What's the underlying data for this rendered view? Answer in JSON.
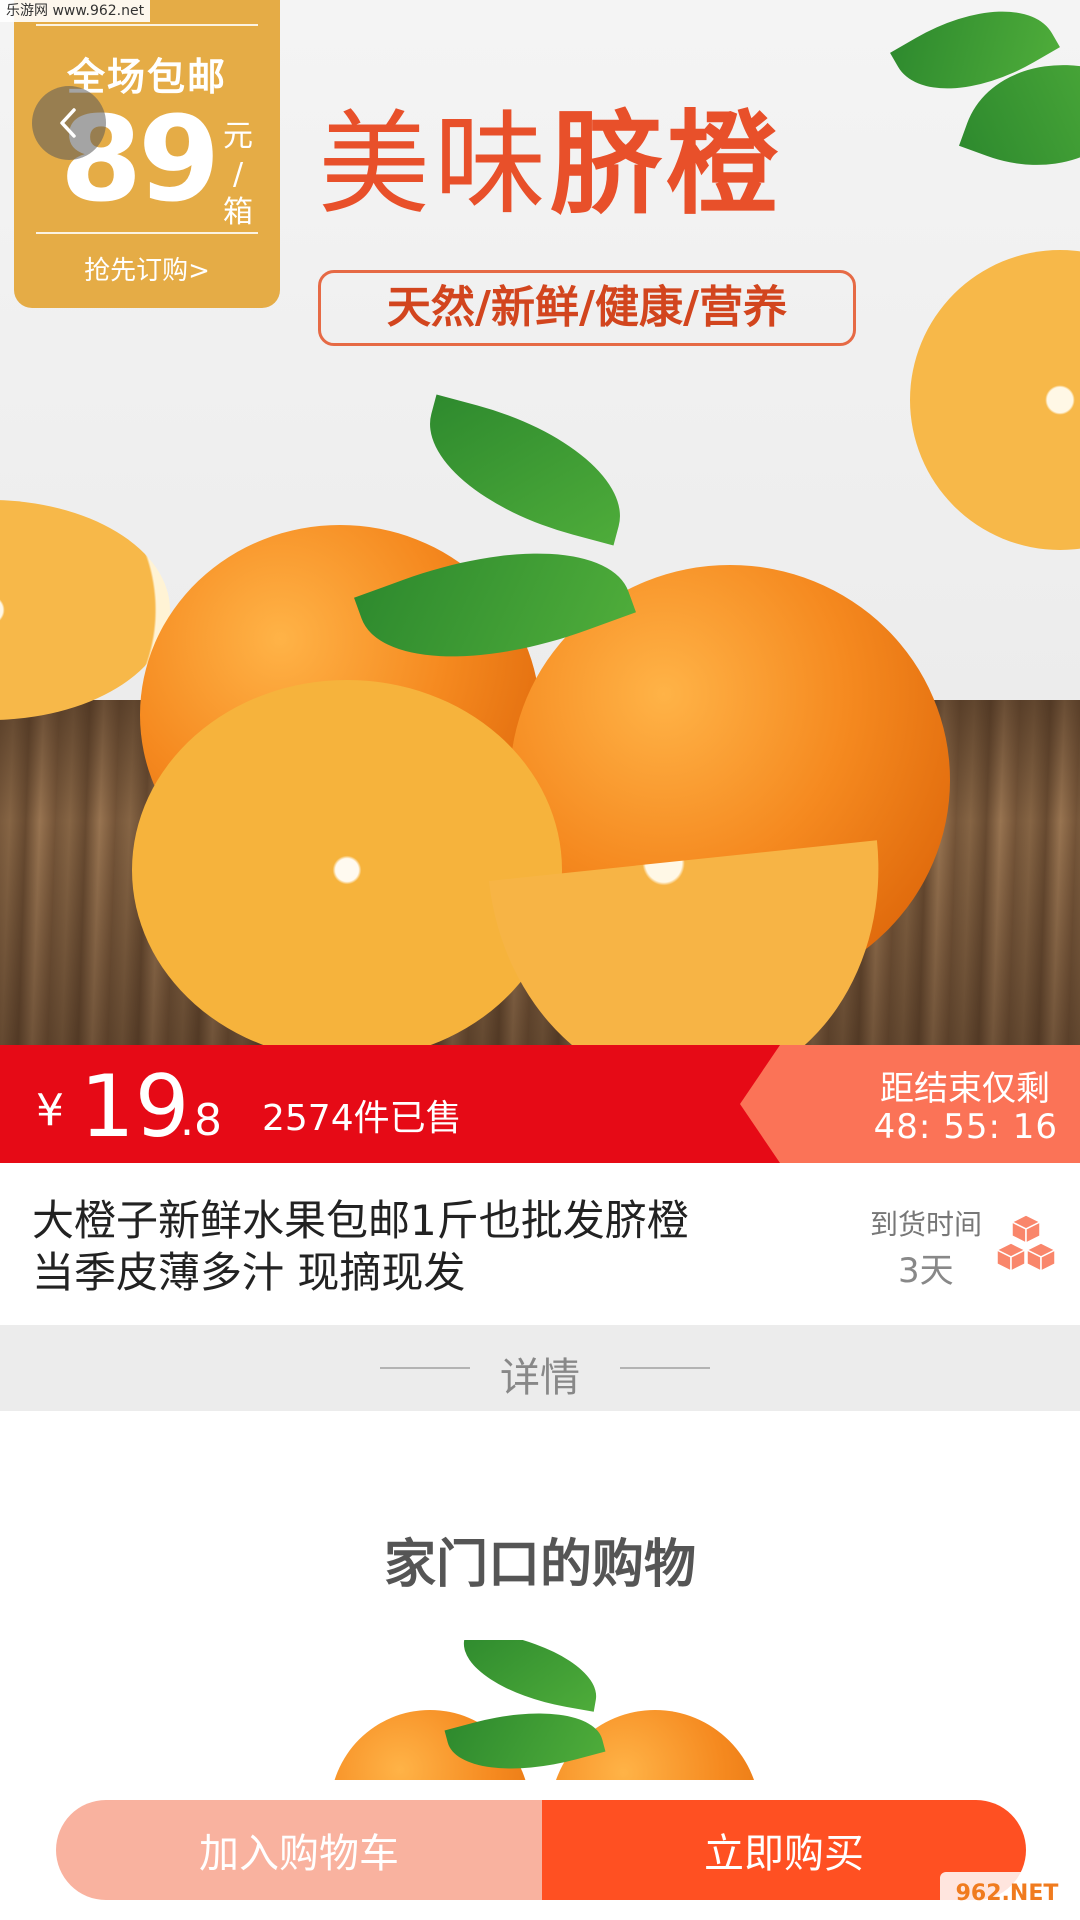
{
  "watermark_top": "乐游网 www.962.net",
  "watermark_bottom": "962.NET",
  "promo": {
    "title": "全场包邮",
    "price": "89",
    "unit_top": "元",
    "unit_bottom": "/箱",
    "cta": "抢先订购>"
  },
  "hero": {
    "title_part1": "美味",
    "title_part2": "脐橙",
    "tagline": "天然/新鲜/健康/营养"
  },
  "price_bar": {
    "currency": "¥",
    "price_int": "19",
    "price_dec": ".8",
    "sold": "2574件已售",
    "countdown_label": "距结束仅剩",
    "countdown_time": "48: 55: 16"
  },
  "product": {
    "title_line1": "大橙子新鲜水果包邮1斤也批发脐橙",
    "title_line2": "当季皮薄多汁 现摘现发",
    "eta_label": "到货时间",
    "eta_value": "3天",
    "icon": "package-icon"
  },
  "divider_label": "详情",
  "detail_heading": "家门口的购物",
  "buttons": {
    "add_to_cart": "加入购物车",
    "buy_now": "立即购买"
  },
  "colors": {
    "price_bar": "#e60a16",
    "countdown": "#fb7357",
    "promo_box": "#e5ac46",
    "cart_button": "#f9b29f",
    "buy_button": "#ff5022",
    "hero_title": "#e8502a"
  },
  "icons": [
    "back-arrow-icon",
    "package-icon"
  ]
}
